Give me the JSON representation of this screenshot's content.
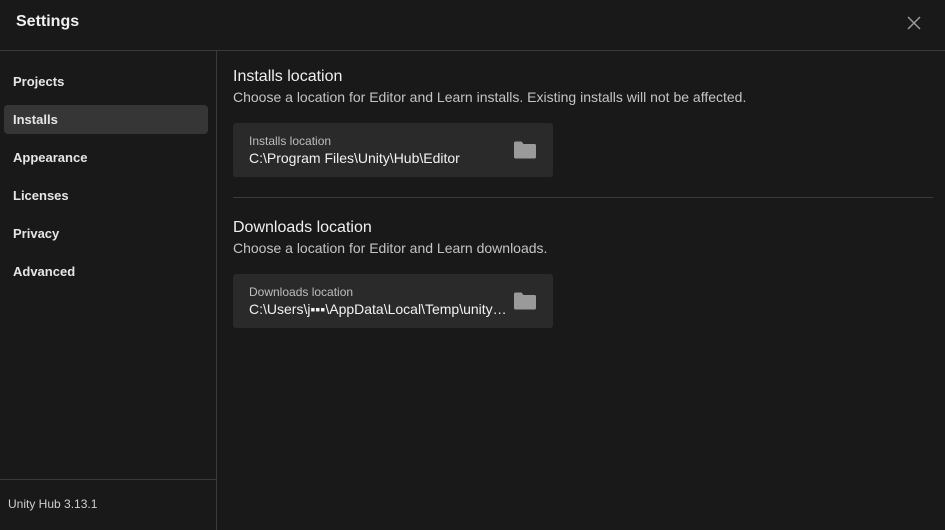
{
  "window": {
    "title": "Settings",
    "close_icon": "close-icon"
  },
  "sidebar": {
    "items": [
      {
        "label": "Projects",
        "active": false
      },
      {
        "label": "Installs",
        "active": true
      },
      {
        "label": "Appearance",
        "active": false
      },
      {
        "label": "Licenses",
        "active": false
      },
      {
        "label": "Privacy",
        "active": false
      },
      {
        "label": "Advanced",
        "active": false
      }
    ],
    "version": "Unity Hub 3.13.1"
  },
  "installs": {
    "title": "Installs location",
    "description": "Choose a location for Editor and Learn installs. Existing installs will not be affected.",
    "field_label": "Installs location",
    "field_value": "C:\\Program Files\\Unity\\Hub\\Editor",
    "icon": "folder-icon"
  },
  "downloads": {
    "title": "Downloads location",
    "description": "Choose a location for Editor and Learn downloads.",
    "field_label": "Downloads location",
    "field_value": "C:\\Users\\j▪▪▪\\AppData\\Local\\Temp\\unityhub",
    "icon": "folder-icon"
  },
  "colors": {
    "background": "#191919",
    "active_item": "#363636",
    "field_background": "#2a2a2a",
    "divider": "#3a3a3a"
  }
}
